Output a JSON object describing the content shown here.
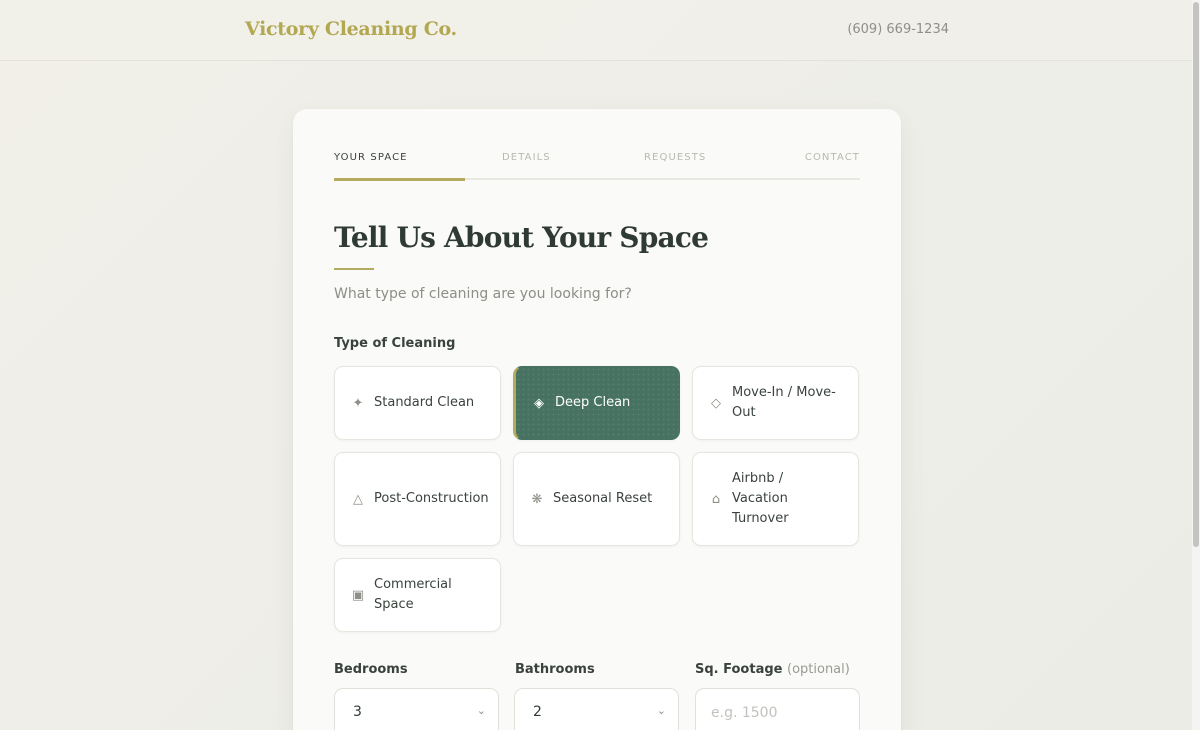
{
  "header": {
    "brand": "Victory Cleaning Co.",
    "phone": "(609) 669-1234"
  },
  "steps": [
    {
      "label": "YOUR SPACE",
      "active": true
    },
    {
      "label": "DETAILS",
      "active": false
    },
    {
      "label": "REQUESTS",
      "active": false
    },
    {
      "label": "CONTACT",
      "active": false
    }
  ],
  "form": {
    "title": "Tell Us About Your Space",
    "subtitle": "What type of cleaning are you looking for?",
    "type_label": "Type of Cleaning",
    "options": [
      {
        "label": "Standard Clean",
        "icon": "sparkle-icon",
        "glyph": "✦",
        "selected": false
      },
      {
        "label": "Deep Clean",
        "icon": "diamond-icon",
        "glyph": "◈",
        "selected": true
      },
      {
        "label": "Move-In / Move-Out",
        "icon": "diamond-outline-icon",
        "glyph": "◇",
        "selected": false
      },
      {
        "label": "Post-Construction",
        "icon": "triangle-icon",
        "glyph": "△",
        "selected": false
      },
      {
        "label": "Seasonal Reset",
        "icon": "snowflake-icon",
        "glyph": "❋",
        "selected": false
      },
      {
        "label": "Airbnb / Vacation Turnover",
        "icon": "house-icon",
        "glyph": "⌂",
        "selected": false
      },
      {
        "label": "Commercial Space",
        "icon": "building-icon",
        "glyph": "▣",
        "selected": false
      }
    ],
    "bedrooms": {
      "label": "Bedrooms",
      "value": "3"
    },
    "bathrooms": {
      "label": "Bathrooms",
      "value": "2"
    },
    "sqft": {
      "label": "Sq. Footage",
      "optional": "(optional)",
      "placeholder": "e.g. 1500",
      "value": ""
    }
  },
  "colors": {
    "accent": "#b5ab5e",
    "brand": "#b3a852",
    "selected": "#477261",
    "text": "#2f3a35"
  }
}
